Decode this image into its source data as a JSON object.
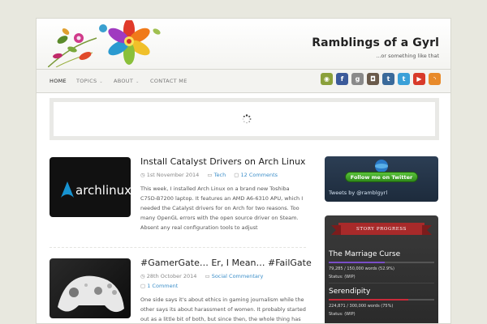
{
  "site": {
    "title": "Ramblings of a Gyrl",
    "tagline": "...or something like that"
  },
  "nav": {
    "items": [
      {
        "label": "HOME",
        "active": true,
        "has_dropdown": false
      },
      {
        "label": "TOPICS",
        "active": false,
        "has_dropdown": true
      },
      {
        "label": "ABOUT",
        "active": false,
        "has_dropdown": true
      },
      {
        "label": "CONTACT ME",
        "active": false,
        "has_dropdown": false
      }
    ],
    "social_icons": [
      {
        "name": "ello-icon",
        "color": "#8aa03a",
        "glyph": "◉"
      },
      {
        "name": "facebook-icon",
        "color": "#3b5a9a",
        "glyph": "f"
      },
      {
        "name": "google-plus-icon",
        "color": "#8a8a8a",
        "glyph": "g"
      },
      {
        "name": "instagram-icon",
        "color": "#6a5a4a",
        "glyph": "◘"
      },
      {
        "name": "tumblr-icon",
        "color": "#3a6a9a",
        "glyph": "t"
      },
      {
        "name": "twitter-icon",
        "color": "#3aa0d8",
        "glyph": "t"
      },
      {
        "name": "youtube-icon",
        "color": "#d83a2a",
        "glyph": "▶"
      },
      {
        "name": "rss-icon",
        "color": "#e88a2a",
        "glyph": "◝"
      }
    ]
  },
  "posts": [
    {
      "title": "Install Catalyst Drivers on Arch Linux",
      "date": "1st November 2014",
      "category": "Tech",
      "comments": "12 Comments",
      "excerpt": "This week, I installed Arch Linux on a brand new Toshiba C75D-B7200 laptop. It features an AMD A6-6310 APU, which I needed the Catalyst drivers for on Arch for two reasons. Too many OpenGL errors with the open source driver on Steam. Absent any real configuration tools to adjust",
      "thumb_text": "archlinux"
    },
    {
      "title": "#GamerGate… Er, I Mean… #FailGate",
      "date": "28th October 2014",
      "category": "Social Commentary",
      "comments": "1 Comment",
      "excerpt": "One side says it's about ethics in gaming journalism while the other says its about harassment of women. It probably started out as a little bit of both, but since then, the whole thing has"
    }
  ],
  "sidebar": {
    "twitter": {
      "follow_label": "Follow me on Twitter",
      "tweets_by": "Tweets by @ramblgyrl"
    },
    "story_progress": {
      "heading": "STORY PROGRESS",
      "stories": [
        {
          "title": "The Marriage Curse",
          "words": "79,285 / 150,000 words (52.9%)",
          "progress": 0.529,
          "status": "Status: (WIP)",
          "color": "#7a4ec8"
        },
        {
          "title": "Serendipity",
          "words": "224,871 / 300,000 words (75%)",
          "progress": 0.75,
          "status": "Status: (WIP)",
          "color": "#c82a3a"
        }
      ]
    }
  }
}
